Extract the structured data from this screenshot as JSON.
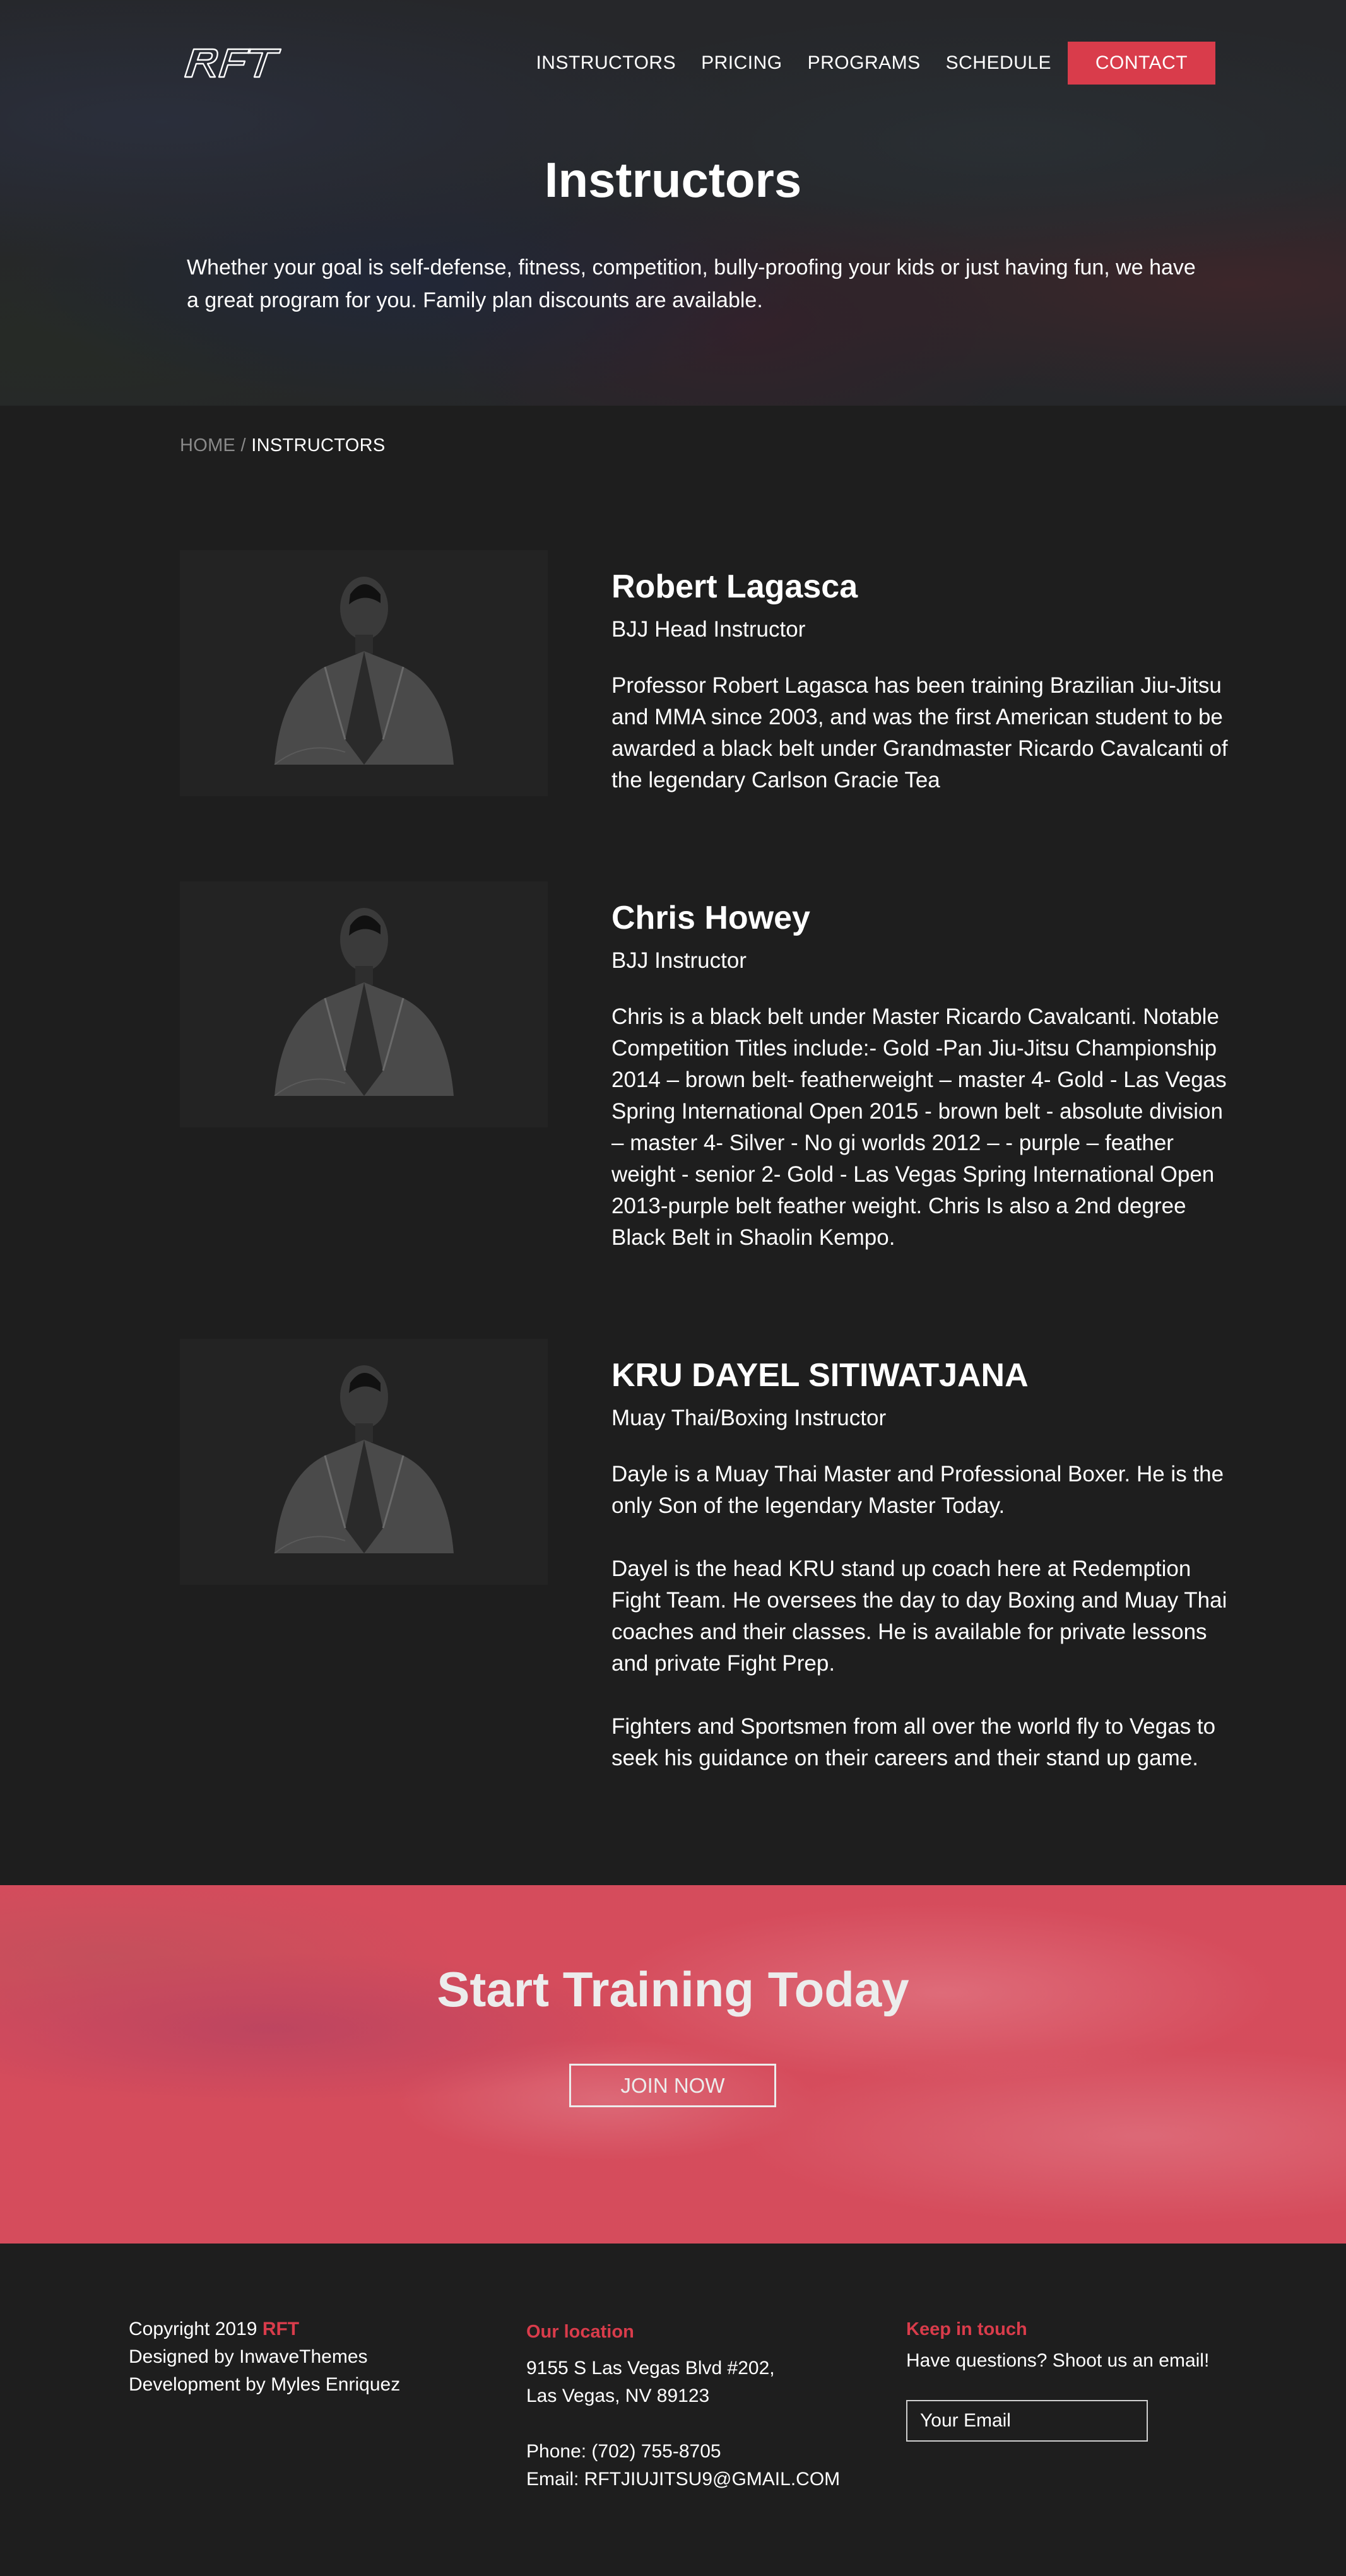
{
  "brand": {
    "logo_text": "RFT",
    "accent_color": "#d93c4b"
  },
  "nav": {
    "items": [
      "INSTRUCTORS",
      "PRICING",
      "PROGRAMS",
      "SCHEDULE"
    ],
    "contact_label": "CONTACT"
  },
  "hero": {
    "title": "Instructors",
    "description": "Whether your goal is self-defense, fitness, competition, bully-proofing your kids or just having fun, we have a great program for you. Family plan discounts are available."
  },
  "breadcrumb": {
    "home": "HOME",
    "separator": " / ",
    "current": "INSTRUCTORS"
  },
  "instructors": [
    {
      "name": "Robert Lagasca",
      "role": "BJJ Head Instructor",
      "bio": [
        "Professor Robert Lagasca has been training Brazilian Jiu-Jitsu and MMA since 2003, and was the first American student to be awarded a black belt under Grandmaster Ricardo Cavalcanti of the legendary Carlson Gracie Tea"
      ]
    },
    {
      "name": "Chris Howey",
      "role": "BJJ Instructor",
      "bio": [
        "Chris is a black belt under Master Ricardo Cavalcanti. Notable Competition Titles include:- Gold -Pan Jiu-Jitsu Championship 2014 – brown belt- featherweight – master 4- Gold - Las Vegas Spring International Open 2015 - brown belt - absolute division – master 4- Silver - No gi worlds 2012 – - purple – feather weight - senior 2- Gold - Las Vegas Spring International Open 2013-purple belt feather weight. Chris Is also a 2nd degree Black Belt in Shaolin Kempo."
      ]
    },
    {
      "name": "KRU DAYEL SITIWATJANA",
      "role": "Muay Thai/Boxing Instructor",
      "bio": [
        "Dayle is a Muay Thai Master and Professional Boxer. He is the only Son of the legendary Master Today.",
        "Dayel is the head KRU stand up coach here at Redemption Fight Team. He oversees the day to day Boxing and Muay Thai coaches and their classes. He is available for private lessons and private Fight Prep.",
        "Fighters and Sportsmen from all over the world fly to Vegas to seek his guidance on their careers and their stand up game."
      ]
    }
  ],
  "cta": {
    "title": "Start Training Today",
    "button_label": "JOIN NOW"
  },
  "footer": {
    "copyright_prefix": "Copyright 2019 ",
    "copyright_brand": "RFT",
    "designed_by": "Designed by InwaveThemes",
    "development_by": "Development by Myles Enriquez",
    "location_heading": "Our location",
    "address_line1": "9155 S Las Vegas Blvd #202,",
    "address_line2": "Las Vegas, NV 89123",
    "phone": "Phone: (702) 755-8705",
    "email": "Email: RFTJIUJITSU9@GMAIL.COM",
    "contact_heading": "Keep in touch",
    "contact_text": "Have questions? Shoot us an email!",
    "email_placeholder": "Your Email"
  }
}
